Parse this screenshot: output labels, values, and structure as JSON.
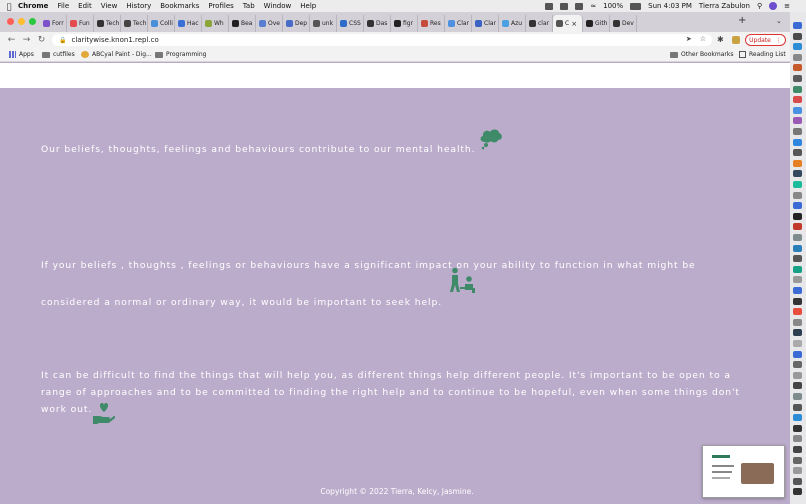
{
  "menubar": {
    "app": "Chrome",
    "items": [
      "File",
      "Edit",
      "View",
      "History",
      "Bookmarks",
      "Profiles",
      "Tab",
      "Window",
      "Help"
    ],
    "battery": "100%",
    "clock": "Sun 4:03 PM",
    "user": "Tierra Zabulon"
  },
  "tabs": [
    {
      "label": "Forr",
      "color": "#7b52c9"
    },
    {
      "label": "Fun",
      "color": "#e24c4c"
    },
    {
      "label": "Tech",
      "color": "#333333"
    },
    {
      "label": "Tech",
      "color": "#444444"
    },
    {
      "label": "Colli",
      "color": "#4a8fd9"
    },
    {
      "label": "Hac",
      "color": "#3a6fd8"
    },
    {
      "label": "Wh",
      "color": "#8aa63a"
    },
    {
      "label": "Bea",
      "color": "#222222"
    },
    {
      "label": "Ove",
      "color": "#5a7fd1"
    },
    {
      "label": "Dep",
      "color": "#4a6cc9"
    },
    {
      "label": "unk",
      "color": "#555555"
    },
    {
      "label": "CSS",
      "color": "#2d6ccb"
    },
    {
      "label": "Das",
      "color": "#333333"
    },
    {
      "label": "figr",
      "color": "#222222"
    },
    {
      "label": "Res",
      "color": "#c84a3a"
    },
    {
      "label": "Clar",
      "color": "#4f91e0"
    },
    {
      "label": "Clar",
      "color": "#3a62c2"
    },
    {
      "label": "Azu",
      "color": "#4aa0e0"
    },
    {
      "label": "clar",
      "color": "#333333"
    },
    {
      "label": "C",
      "color": "#555555",
      "active": true
    },
    {
      "label": "Gith",
      "color": "#222222"
    },
    {
      "label": "Dev",
      "color": "#333333"
    }
  ],
  "toolbar": {
    "url": "claritywise.knon1.repl.co",
    "update_label": "Update"
  },
  "bookmarks": {
    "apps": "Apps",
    "items": [
      "cutfiles",
      "ABCyal Paint - Dig...",
      "Programming"
    ],
    "other": "Other Bookmarks",
    "reading": "Reading List"
  },
  "content": {
    "paragraph1": "Our beliefs, thoughts, feelings and behaviours contribute to our mental health.",
    "paragraph2": "If your beliefs , thoughts , feelings or behaviours have a significant impact on your ability to function in what might be considered a normal or ordinary way, it would be important to seek help.",
    "paragraph3": "It can be difficult to find the things that will help you, as different things help different people. It's important to be open to a range of approaches and to be committed to finding the right help and to continue to be hopeful, even when some things don't work out.",
    "copyright": "Copyright © 2022 Tierra, Kelcy, Jasmine.",
    "accent_color": "#3f8a68",
    "background_color": "#bcaccb"
  }
}
